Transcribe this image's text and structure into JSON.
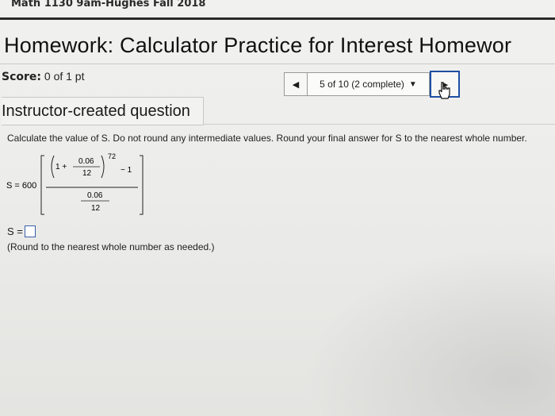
{
  "course": {
    "title": "Math 1130 9am-Hughes Fall 2018"
  },
  "homework": {
    "title": "Homework: Calculator Practice for Interest Homewor"
  },
  "score": {
    "label": "Score:",
    "value": "0 of 1 pt"
  },
  "nav": {
    "position": "5 of 10 (2 complete)",
    "prev_icon": "caret-left-icon",
    "next_icon": "caret-right-icon",
    "dropdown_icon": "caret-down-icon"
  },
  "question": {
    "type_label": "Instructor-created question",
    "prompt": "Calculate the value of S.  Do not round any intermediate values.  Round your final answer for S to the nearest whole number.",
    "formula": {
      "lhs": "S = 600",
      "inner_prefix": "1 +",
      "inner_num": "0.06",
      "inner_den": "12",
      "exponent": "72",
      "minus_one": "− 1",
      "outer_num": "0.06",
      "outer_den": "12"
    },
    "answer_label": "S =",
    "answer_value": "",
    "hint": "(Round to the nearest whole number as needed.)"
  },
  "colors": {
    "nav_accent": "#1d4fa3",
    "answer_box_border": "#3a5fa8"
  }
}
